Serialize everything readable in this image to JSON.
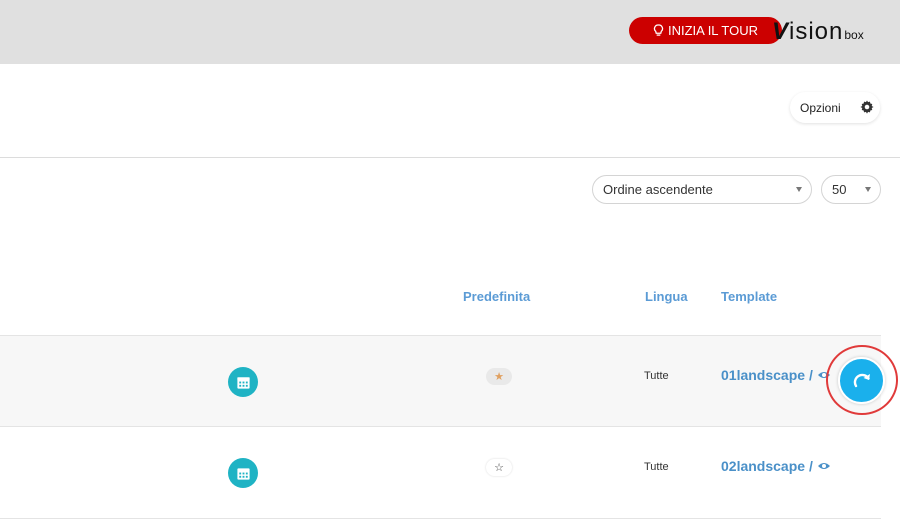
{
  "header": {
    "tour_label": "INIZIA IL TOUR",
    "logo_main": "ision",
    "logo_v": "V",
    "logo_sub": "box"
  },
  "toolbar": {
    "options_label": "Opzioni"
  },
  "filters": {
    "order_value": "Ordine ascendente",
    "limit_value": "50"
  },
  "table": {
    "headers": {
      "predefinita": "Predefinita",
      "lingua": "Lingua",
      "template": "Template"
    },
    "rows": [
      {
        "default": true,
        "lang": "Tutte",
        "template": "01landscape /"
      },
      {
        "default": false,
        "lang": "Tutte",
        "template": "02landscape /"
      }
    ]
  },
  "colors": {
    "accent_red": "#cc0000",
    "link_blue": "#4a90c8",
    "teal": "#1fb3c4",
    "refresh_blue": "#1ab0ec"
  }
}
